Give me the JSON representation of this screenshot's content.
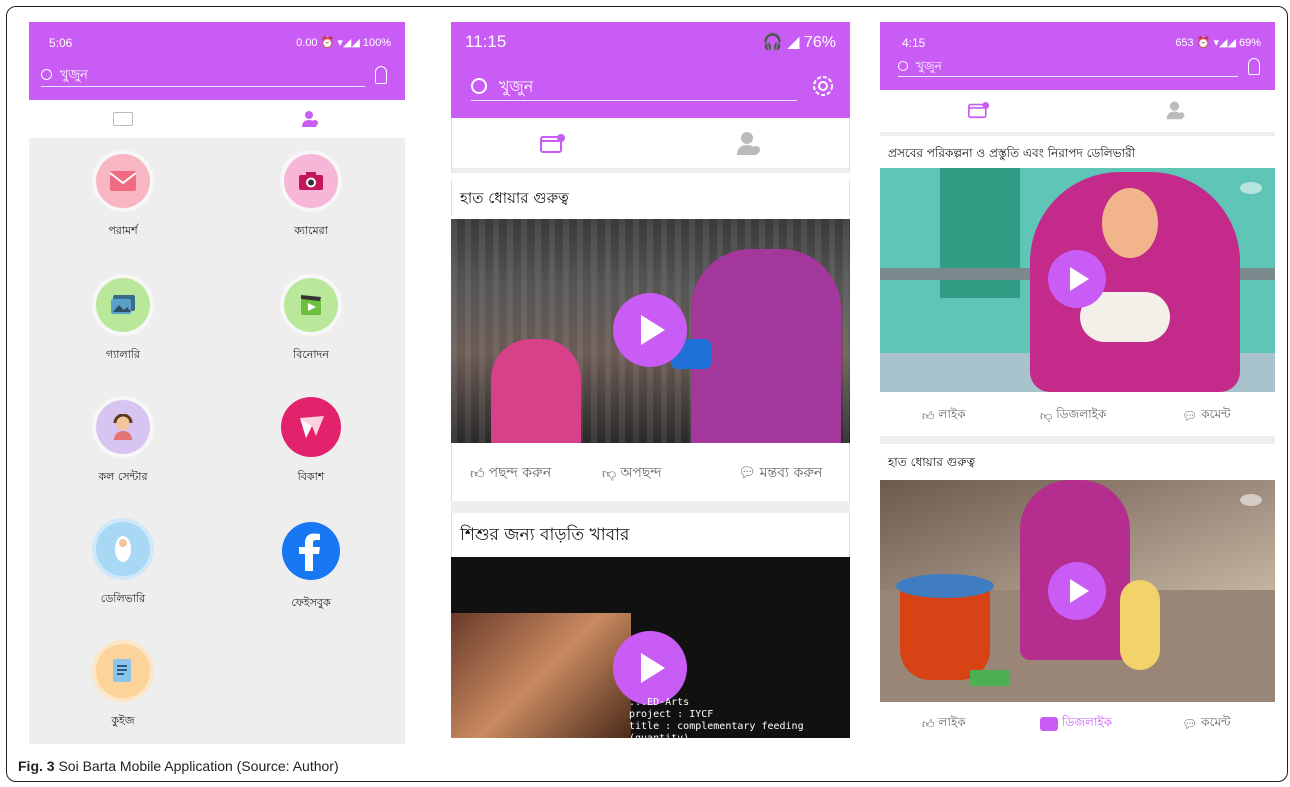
{
  "caption": {
    "label": "Fig. 3",
    "text": "Soi Barta Mobile Application (Source: Author)"
  },
  "screens": [
    {
      "status": {
        "time": "5:06",
        "right": "0.00 ⏰ ▾◢◢ 100%"
      },
      "search": {
        "placeholder": "খুজুন"
      },
      "apps": [
        {
          "label": "পরামর্শ",
          "icon": "envelope-icon",
          "color": "#f7b6c2"
        },
        {
          "label": "ক্যামেরা",
          "icon": "camera-icon",
          "color": "#f7b6d8"
        },
        {
          "label": "গ্যালারি",
          "icon": "gallery-icon",
          "color": "#b9e89a"
        },
        {
          "label": "বিনোদন",
          "icon": "film-icon",
          "color": "#b9e89a"
        },
        {
          "label": "কল সেন্টার",
          "icon": "operator-icon",
          "color": "#d8c4f0"
        },
        {
          "label": "বিকাশ",
          "icon": "bkash-bird-icon",
          "color": "#e2236b"
        },
        {
          "label": "ডেলিভারি",
          "icon": "baby-icon",
          "color": "#a9d8f5"
        },
        {
          "label": "ফেইসবুক",
          "icon": "facebook-icon",
          "color": "#1877f2"
        },
        {
          "label": "কুইজ",
          "icon": "quiz-icon",
          "color": "#fcd39a"
        }
      ]
    },
    {
      "status": {
        "time": "11:15",
        "right": "🎧 ◢ 76%"
      },
      "search": {
        "placeholder": "খুজুন"
      },
      "cards": [
        {
          "title": "হাত ধোয়ার গুরুত্ব"
        },
        {
          "title": "শিশুর জন্য বাড়তি খাবার",
          "overlay": [
            "...ED-Arts",
            "project : IYCF",
            "title : complementary feeding (quantity)"
          ]
        }
      ],
      "actions": {
        "like": "পছন্দ করুন",
        "dislike": "অপছন্দ",
        "comment": "মন্তব্য করুন"
      }
    },
    {
      "status": {
        "time": "4:15",
        "right": "653 ⏰ ▾◢◢ 69%"
      },
      "search": {
        "placeholder": "খুজুন"
      },
      "cards": [
        {
          "title": "প্রসবের পরিকল্পনা ও প্রস্তুতি এবং নিরাপদ ডেলিভারী"
        },
        {
          "title": "হাত ধোয়ার গুরুত্ব"
        }
      ],
      "actions": {
        "like": "লাইক",
        "dislike": "ডিজলাইক",
        "comment": "কমেন্ট"
      }
    }
  ],
  "colors": {
    "accent": "#c85cf5"
  }
}
